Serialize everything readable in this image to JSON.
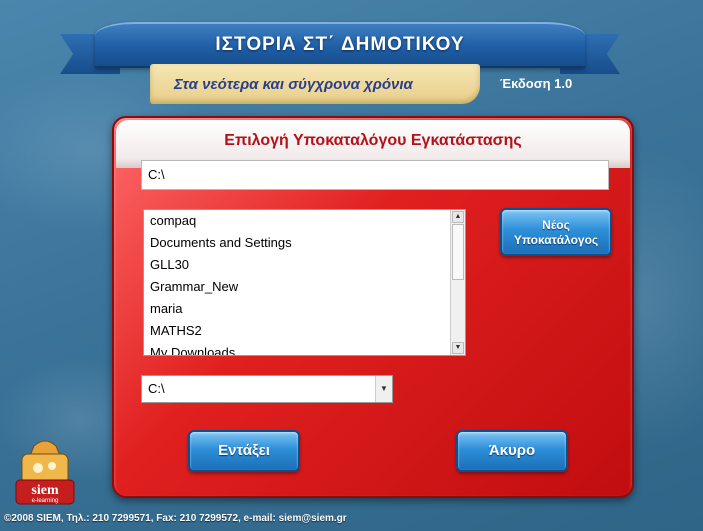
{
  "header": {
    "title": "ΙΣΤΟΡΙΑ ΣΤ΄ ΔΗΜΟΤΙΚΟΥ",
    "subtitle": "Στα νεότερα και σύγχρονα χρόνια",
    "version": "Έκδοση 1.0"
  },
  "dialog": {
    "title": "Επιλογή Υποκαταλόγου Εγκατάστασης",
    "path_value": "C:\\",
    "folders": [
      "compaq",
      "Documents and Settings",
      "GLL30",
      "Grammar_New",
      "maria",
      "MATHS2",
      "My Downloads"
    ],
    "new_folder_label_1": "Νέος",
    "new_folder_label_2": "Υποκατάλογος",
    "drive_value": "C:\\",
    "ok_label": "Εντάξει",
    "cancel_label": "Άκυρο"
  },
  "logo": {
    "brand": "siem",
    "tagline": "e-learning"
  },
  "footer": {
    "text": "©2008 SIEM,  Τηλ.: 210 7299571, Fax: 210 7299572, e-mail: siem@siem.gr"
  },
  "colors": {
    "background": "#3a7399",
    "ribbon": "#1f5ea5",
    "dialog": "#e0201f",
    "title_red": "#b3121a",
    "button_blue": "#2d8fd8"
  }
}
